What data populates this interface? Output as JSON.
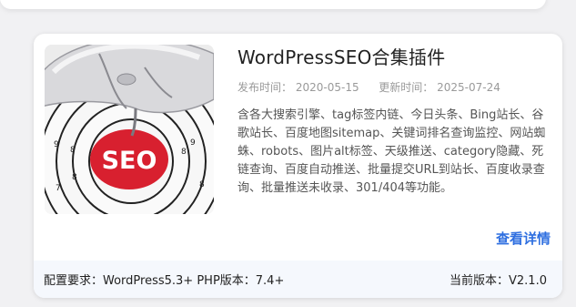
{
  "card": {
    "title": "WordPressSEO合集插件",
    "publish_label": "发布时间：",
    "publish_date": "2020-05-15",
    "update_label": "更新时间：",
    "update_date": "2025-07-24",
    "description": "含各大搜索引擎、tag标签内链、今日头条、Bing站长、谷歌站长、百度地图sitemap、关键词排名查询监控、网站蜘蛛、robots、图片alt标签、天级推送、category隐藏、死链查询、百度自动推送、批量提交URL到站长、百度收录查询、批量推送未收录、301/404等功能。",
    "detail_link": "查看详情",
    "requirements": "配置要求：WordPress5.3+ PHP版本：7.4+",
    "current_version": "当前版本：V2.1.0",
    "thumbnail": {
      "badge_text": "SEO",
      "ring_numbers": [
        "8",
        "7",
        "8",
        "9",
        "9",
        "8",
        "8",
        "7",
        "8"
      ]
    }
  },
  "colors": {
    "link": "#2f6fe0",
    "footer_bg": "#f5f8fd",
    "seo_red": "#d8202f"
  }
}
